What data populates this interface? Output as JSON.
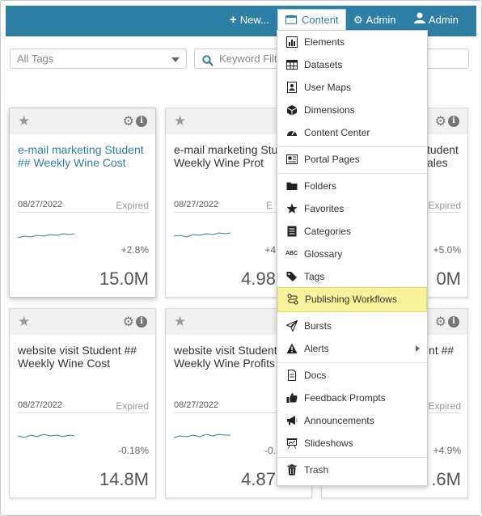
{
  "topbar": {
    "new_label": "New...",
    "content_label": "Content",
    "admin_label": "Admin",
    "user_label": "Admin"
  },
  "filters": {
    "tags_value": "All Tags",
    "keyword_placeholder": "Keyword Filt"
  },
  "cards": [
    {
      "title": "e-mail marketing Student ## Weekly Wine Cost",
      "date": "08/27/2022",
      "status": "Expired",
      "change": "+2.8%",
      "value": "15.0M"
    },
    {
      "title": "e-mail marketing Stu ## Weekly Wine Prot",
      "date": "08/27/2022",
      "status": "E",
      "change": "+4",
      "value": "4.98"
    },
    {
      "title": "tudent ales",
      "date": "",
      "status": "Expired",
      "change": "+5.0%",
      "value": "0M"
    },
    {
      "title": "website visit Student ## Weekly Wine Cost",
      "date": "08/27/2022",
      "status": "Expired",
      "change": "-0.18%",
      "value": "14.8M"
    },
    {
      "title": "website visit Student Weekly Wine Profits",
      "date": "08/27/2022",
      "status": "",
      "change": "-0.",
      "value": "4.87"
    },
    {
      "title": "nt ##",
      "date": "",
      "status": "Expired",
      "change": "+4.9%",
      "value": ".6M"
    }
  ],
  "menu": {
    "items": [
      {
        "label": "Elements",
        "icon": "bar-chart-icon"
      },
      {
        "label": "Datasets",
        "icon": "table-icon"
      },
      {
        "label": "User Maps",
        "icon": "user-map-icon"
      },
      {
        "label": "Dimensions",
        "icon": "cube-icon"
      },
      {
        "label": "Content Center",
        "icon": "dashboard-icon"
      },
      {
        "label": "Portal Pages",
        "icon": "portal-icon"
      },
      {
        "label": "Folders",
        "icon": "folder-icon"
      },
      {
        "label": "Favorites",
        "icon": "star-icon"
      },
      {
        "label": "Categories",
        "icon": "list-icon"
      },
      {
        "label": "Glossary",
        "icon": "abc-icon"
      },
      {
        "label": "Tags",
        "icon": "tags-icon"
      },
      {
        "label": "Publishing Workflows",
        "icon": "workflow-icon"
      },
      {
        "label": "Bursts",
        "icon": "paper-plane-icon"
      },
      {
        "label": "Alerts",
        "icon": "warning-icon"
      },
      {
        "label": "Docs",
        "icon": "doc-icon"
      },
      {
        "label": "Feedback Prompts",
        "icon": "thumbs-up-icon"
      },
      {
        "label": "Announcements",
        "icon": "megaphone-icon"
      },
      {
        "label": "Slideshows",
        "icon": "slideshow-icon"
      },
      {
        "label": "Trash",
        "icon": "trash-icon"
      }
    ],
    "highlighted": "Publishing Workflows"
  },
  "colors": {
    "topbar": "#2e7fa6",
    "highlight": "#f7f39a",
    "sparkline": "#2e7fa6"
  }
}
